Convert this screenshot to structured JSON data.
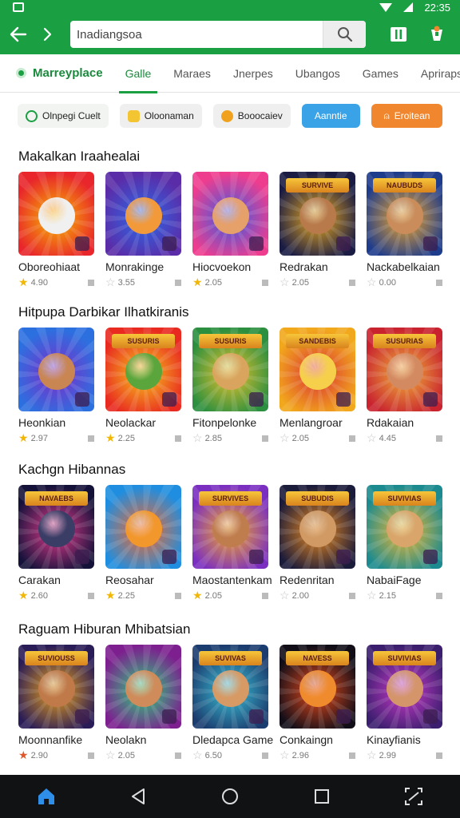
{
  "status": {
    "time": "22:35"
  },
  "search": {
    "value": "Inadiangsoa"
  },
  "tabs": [
    "Marreyplace",
    "Galle",
    "Maraes",
    "Jnerpes",
    "Ubangos",
    "Games",
    "Apriraps"
  ],
  "chips": [
    "Olnpegi Cuelt",
    "Oloonaman",
    "Booocaiev",
    "Aanntie",
    "Eroitean"
  ],
  "colors": {
    "brand": "#1aa043",
    "accent_blue": "#3aa3e8",
    "accent_orange": "#f0872e",
    "star": "#f2b705"
  },
  "sections": [
    {
      "title": "Makalkan Iraahealai",
      "cards": [
        {
          "name": "Oboreohiaat",
          "rating": "4.90",
          "star": "yellow",
          "bg": [
            "#e8262b",
            "#f7b500"
          ],
          "face": "#f0f0f0"
        },
        {
          "name": "Monrakinge",
          "rating": "3.55",
          "star": "grey",
          "bg": [
            "#5b2ca8",
            "#2a6ae8"
          ],
          "face": "#f29a3a"
        },
        {
          "name": "Hiocvoekon",
          "rating": "2.05",
          "star": "yellow",
          "bg": [
            "#ee3d8f",
            "#3b5ce0"
          ],
          "face": "#e6a06a"
        },
        {
          "name": "Redrakan",
          "rating": "2.05",
          "star": "grey",
          "bg": [
            "#1a1c44",
            "#e8a91e"
          ],
          "face": "#b87a4b",
          "banner": "SURVIVE"
        },
        {
          "name": "Nackabelkaian",
          "rating": "0.00",
          "star": "grey",
          "bg": [
            "#1e3c8c",
            "#f0a628"
          ],
          "face": "#c98c5a",
          "banner": "NAUBUDS"
        }
      ]
    },
    {
      "title": "Hitpupa Darbikar Ilhatkiranis",
      "cards": [
        {
          "name": "Heonkian",
          "rating": "2.97",
          "star": "yellow",
          "bg": [
            "#2c70e0",
            "#7d2dc8"
          ],
          "face": "#c98552"
        },
        {
          "name": "Neolackar",
          "rating": "2.25",
          "star": "yellow",
          "bg": [
            "#e82a20",
            "#f7c31d"
          ],
          "face": "#5aa63c",
          "banner": "SUSURIS"
        },
        {
          "name": "Fitonpelonke",
          "rating": "2.85",
          "star": "grey",
          "bg": [
            "#2b8f3f",
            "#e6c02c"
          ],
          "face": "#d9a55e",
          "banner": "SUSURIS"
        },
        {
          "name": "Menlangroar",
          "rating": "2.05",
          "star": "grey",
          "bg": [
            "#f2a81c",
            "#d93434"
          ],
          "face": "#f6d04a",
          "banner": "SANDEBIS"
        },
        {
          "name": "Rdakaian",
          "rating": "4.45",
          "star": "grey",
          "bg": [
            "#c8232f",
            "#f0b038"
          ],
          "face": "#d48a60",
          "banner": "SUSURIAS"
        }
      ]
    },
    {
      "title": "Kachgn Hibannas",
      "cards": [
        {
          "name": "Carakan",
          "rating": "2.60",
          "star": "yellow",
          "bg": [
            "#15123a",
            "#e23a8c"
          ],
          "face": "#3a3d66",
          "banner": "NAVAEBS"
        },
        {
          "name": "Reosahar",
          "rating": "2.25",
          "star": "yellow",
          "bg": [
            "#1f8ee0",
            "#f5672a"
          ],
          "face": "#f2972c"
        },
        {
          "name": "Maostantenkam",
          "rating": "2.05",
          "star": "yellow",
          "bg": [
            "#7b2fc0",
            "#f2a628"
          ],
          "face": "#bf7d4e",
          "banner": "SURVIVES"
        },
        {
          "name": "Redenritan",
          "rating": "2.00",
          "star": "grey",
          "bg": [
            "#1b1b3a",
            "#ea8a1e"
          ],
          "face": "#d19a64",
          "banner": "SUBUDIS"
        },
        {
          "name": "NabaiFage",
          "rating": "2.15",
          "star": "grey",
          "bg": [
            "#1c8b8f",
            "#f0b72e"
          ],
          "face": "#d9a56a",
          "banner": "SUVIVIAS"
        }
      ]
    },
    {
      "title": "Raguam Hiburan Mhibatsian",
      "cards": [
        {
          "name": "Moonnanfike",
          "rating": "2.90",
          "star": "orange",
          "bg": [
            "#2a1c56",
            "#e8a11c"
          ],
          "face": "#c07a4a",
          "banner": "SUVIOUSS"
        },
        {
          "name": "Neolakn",
          "rating": "2.05",
          "star": "grey",
          "bg": [
            "#7d1f8f",
            "#2ad07a"
          ],
          "face": "#cf8c5a"
        },
        {
          "name": "Dledapca Game",
          "rating": "6.50",
          "star": "grey",
          "bg": [
            "#1b3c6e",
            "#3ac0d6"
          ],
          "face": "#d79a64",
          "banner": "SUVIVAS"
        },
        {
          "name": "Conkaingn",
          "rating": "2.96",
          "star": "grey",
          "bg": [
            "#120e18",
            "#e84a1c"
          ],
          "face": "#f08b2d",
          "banner": "NAVESS"
        },
        {
          "name": "Kinayfianis",
          "rating": "2.99",
          "star": "grey",
          "bg": [
            "#3b1e6e",
            "#c93ac8"
          ],
          "face": "#d4956a",
          "banner": "SUVIVIAS"
        }
      ]
    }
  ]
}
